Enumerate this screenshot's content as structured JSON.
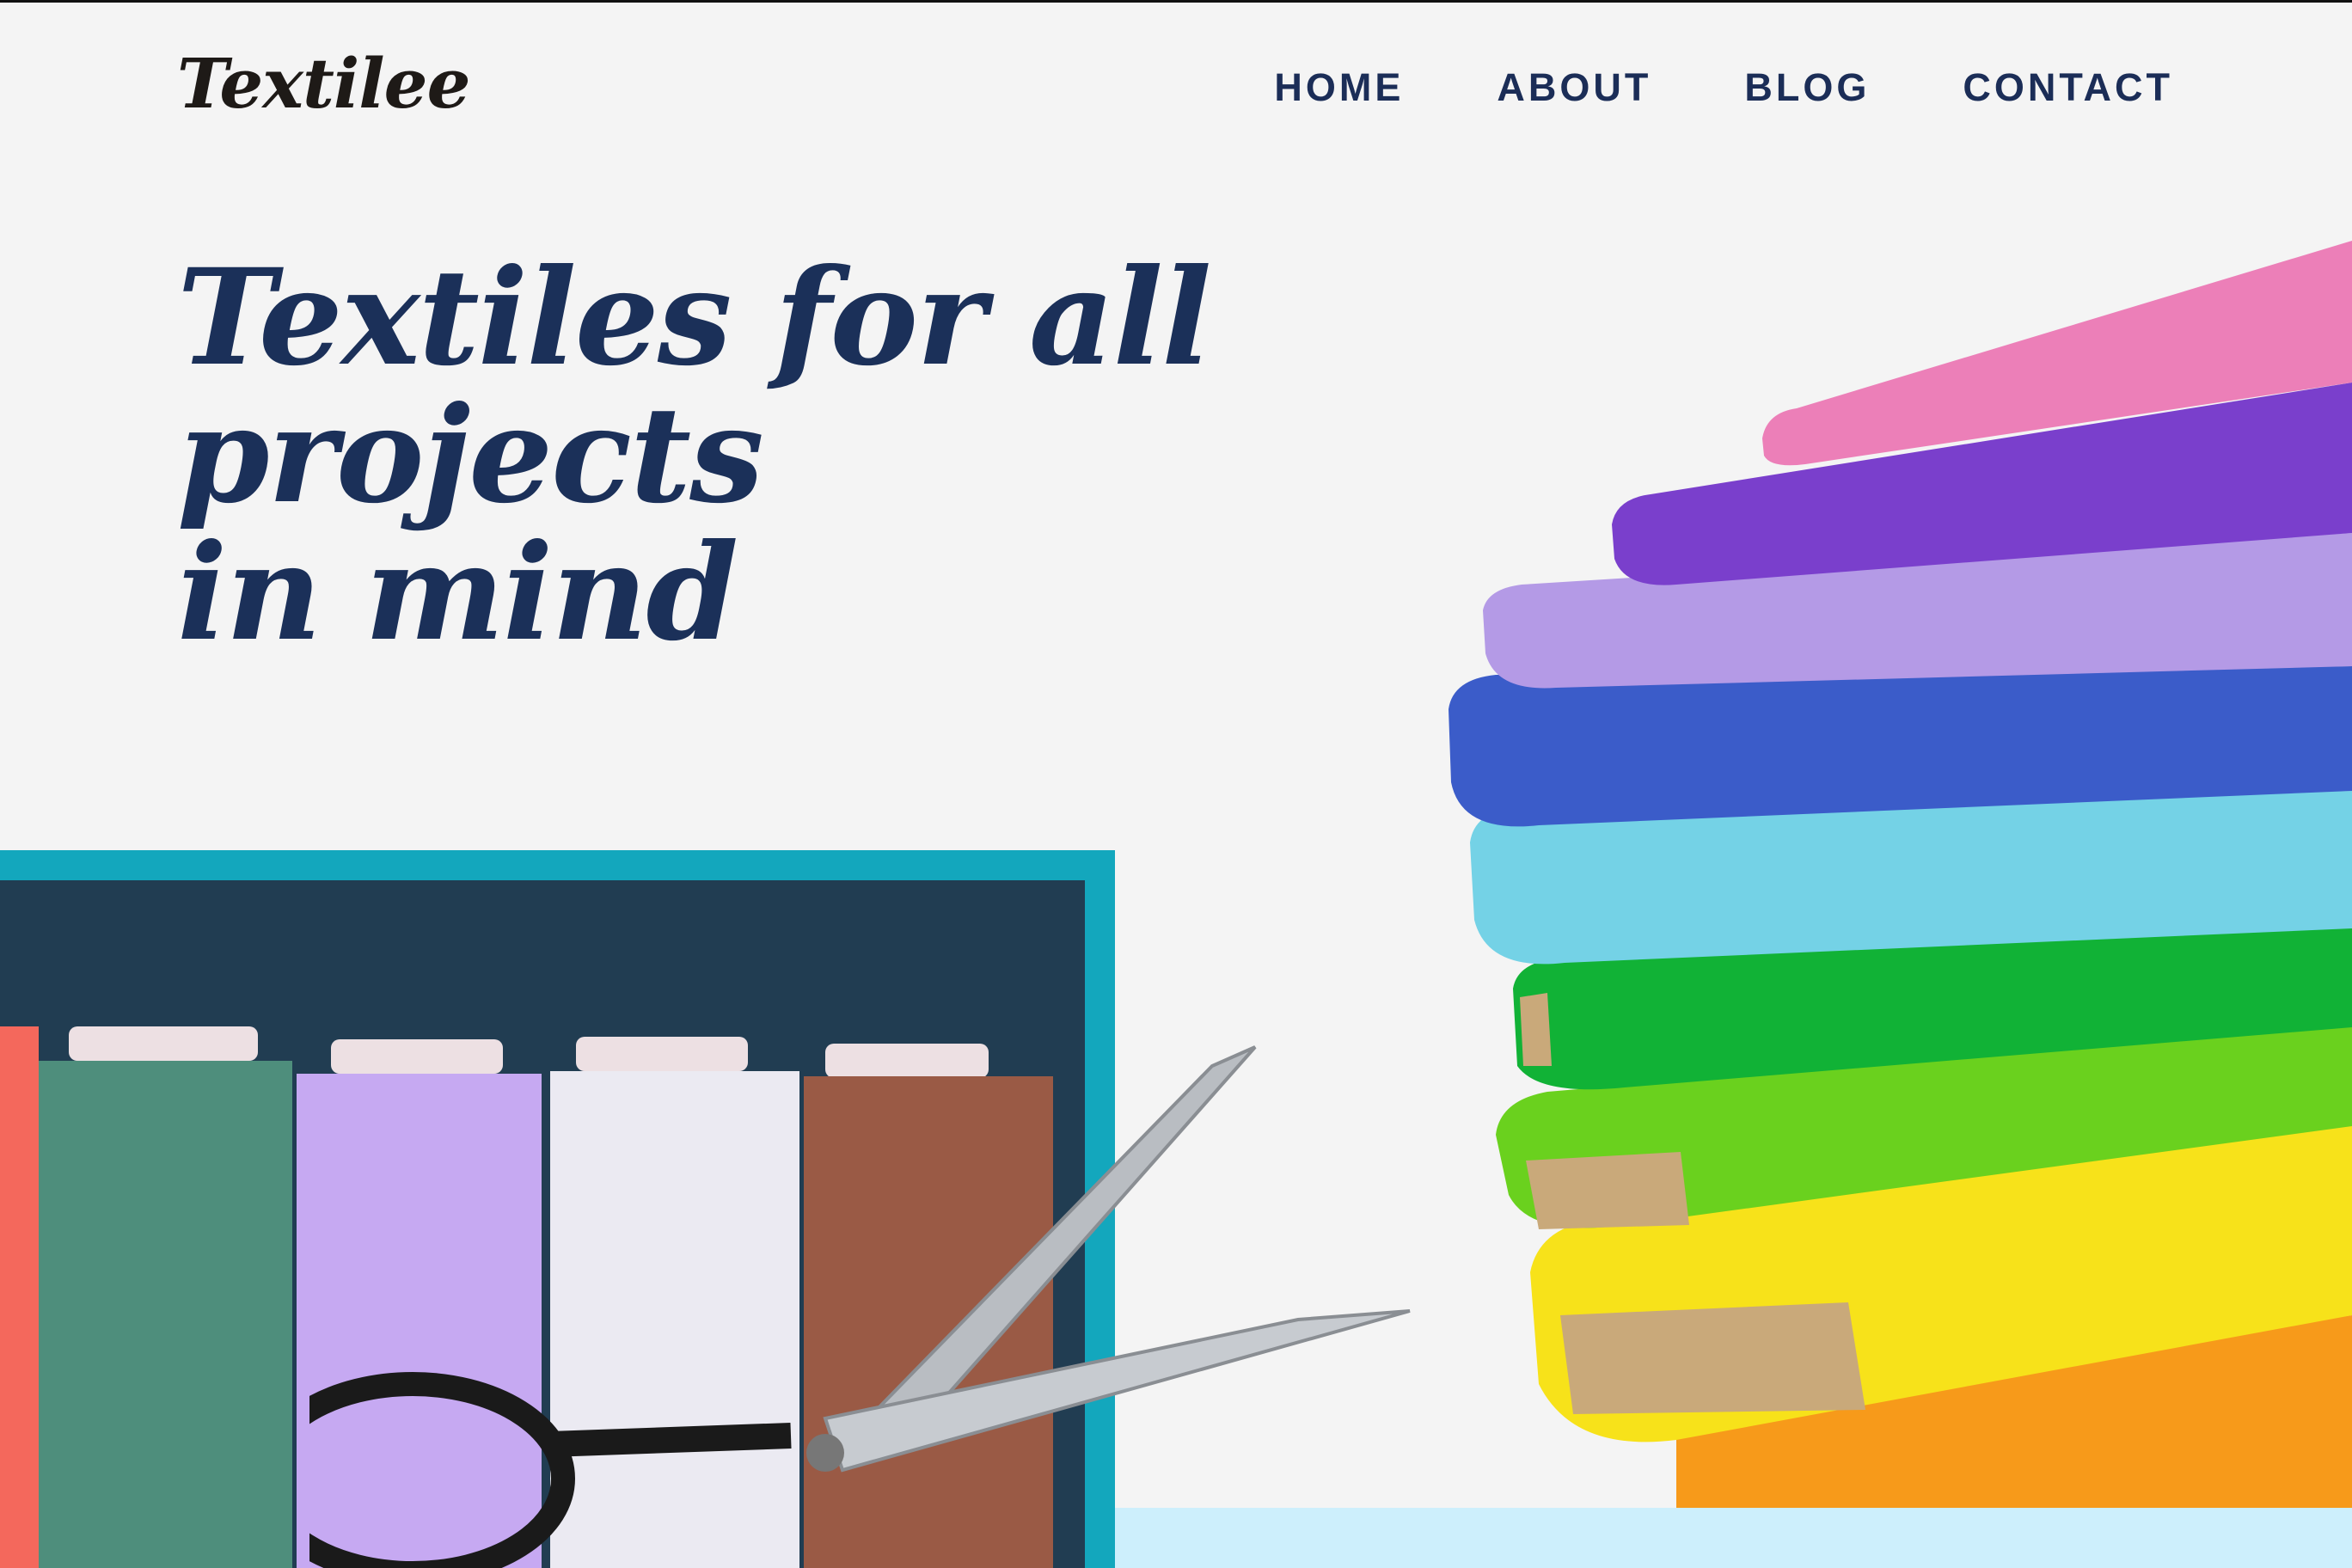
{
  "brand": {
    "name": "Textilee"
  },
  "nav": {
    "items": [
      {
        "label": "HOME"
      },
      {
        "label": "ABOUT"
      },
      {
        "label": "BLOG"
      },
      {
        "label": "CONTACT"
      }
    ]
  },
  "hero": {
    "title_line1": "Textiles for all projects",
    "title_line2": "in mind"
  },
  "colors": {
    "background": "#f4f4f4",
    "navy": "#1b3059",
    "teal_frame": "#13a7bd",
    "panel_dark": "#213d52",
    "strip_light_blue": "#cdeffc"
  },
  "images": {
    "fabric_stack": "rainbow-fabric-bolts-image",
    "threads": "thread-spools-image",
    "scissors": "scissors-image"
  }
}
